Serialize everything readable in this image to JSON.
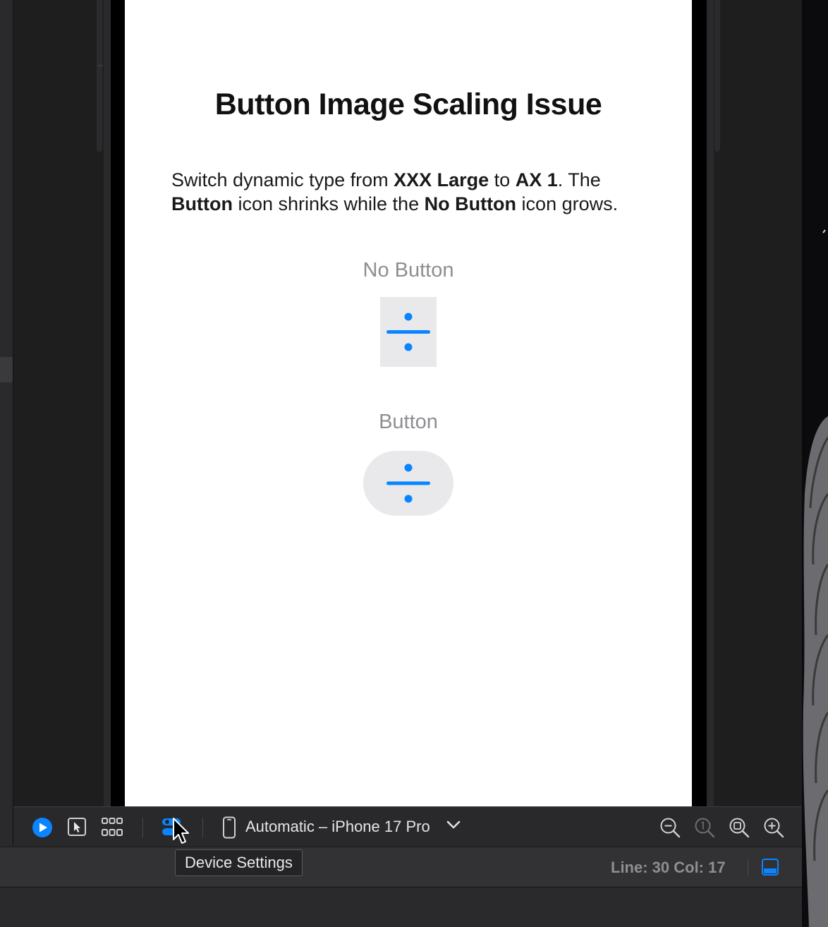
{
  "preview": {
    "title": "Button Image Scaling Issue",
    "body": {
      "p1": "Switch dynamic type from ",
      "b1": "XXX Large",
      "p2": " to ",
      "b2": "AX 1",
      "p3": ". The ",
      "b3": "Button",
      "p4": " icon shrinks while the ",
      "b4": "No Button",
      "p5": " icon grows."
    },
    "no_button_label": "No Button",
    "button_label": "Button"
  },
  "toolbar": {
    "device_selector": "Automatic – iPhone 17 Pro"
  },
  "tooltip": {
    "text": "Device Settings"
  },
  "status": {
    "line_col": "Line: 30  Col: 17"
  },
  "colors": {
    "accent": "#0a84ff",
    "icon_blue": "#0a84ff",
    "label_gray": "#8e8e93",
    "tile_bg": "#e9e9eb"
  },
  "icons": {
    "play": "play-icon",
    "select": "cursor-select-icon",
    "variants": "grid-icon",
    "device_settings": "device-settings-icon",
    "device": "iphone-icon",
    "chevron": "chevron-down-icon",
    "zoom_out": "zoom-out-icon",
    "zoom_actual": "zoom-100-icon",
    "zoom_fit": "zoom-fit-icon",
    "zoom_in": "zoom-in-icon",
    "panel": "bottom-panel-icon",
    "divide": "divide-icon"
  }
}
